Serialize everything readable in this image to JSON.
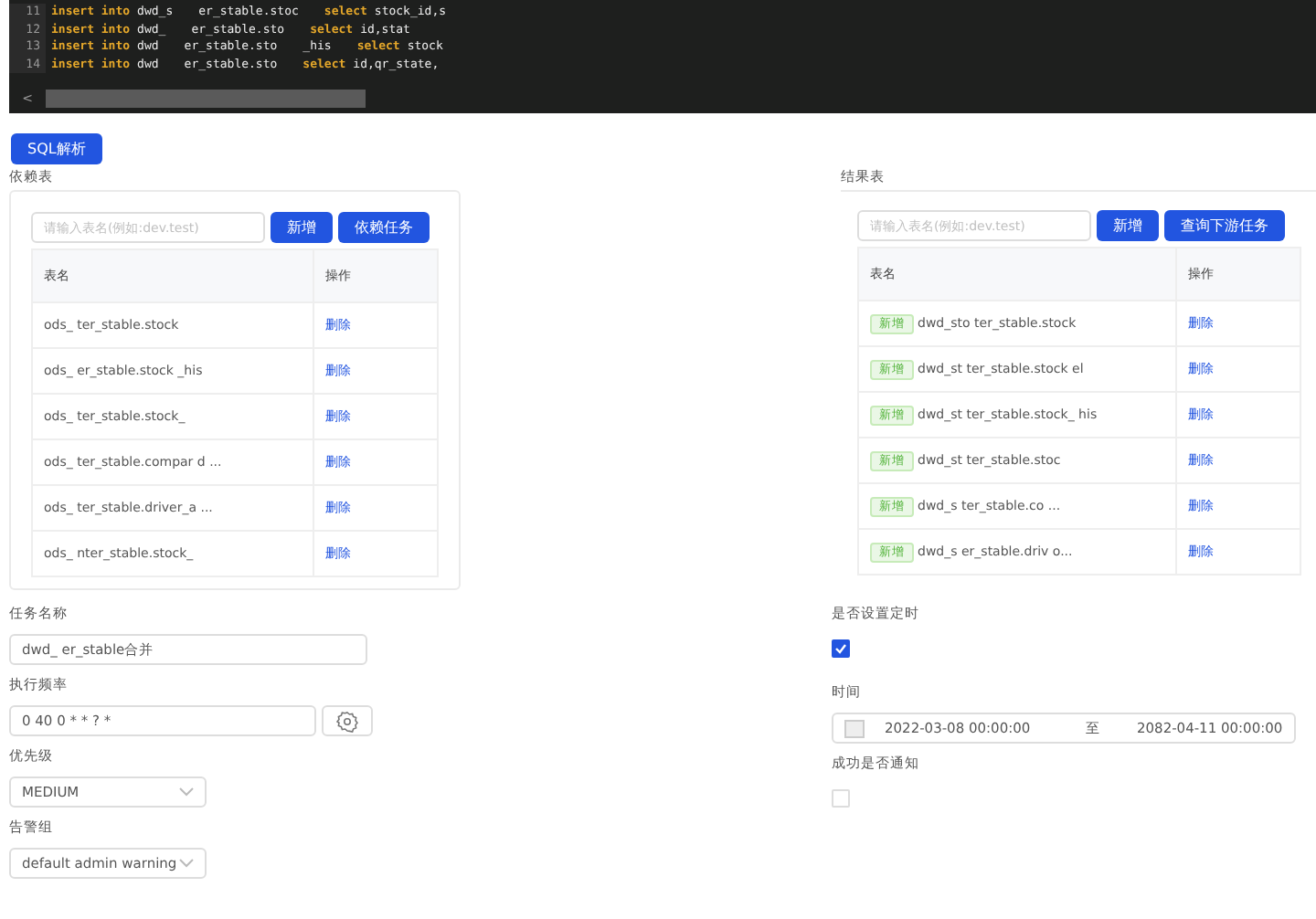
{
  "editor": {
    "lines": [
      {
        "number": "11",
        "tokens": [
          {
            "kind": "keyword",
            "text": "insert into"
          },
          {
            "kind": "text",
            "text": "dwd_s"
          },
          {
            "kind": "text",
            "text": "er_stable.stoc"
          },
          {
            "kind": "keyword",
            "text": "select"
          },
          {
            "kind": "text",
            "text": "stock_id,s"
          }
        ]
      },
      {
        "number": "12",
        "tokens": [
          {
            "kind": "keyword",
            "text": "insert into"
          },
          {
            "kind": "text",
            "text": "dwd_"
          },
          {
            "kind": "text",
            "text": "er_stable.sto"
          },
          {
            "kind": "keyword",
            "text": "select"
          },
          {
            "kind": "text",
            "text": "id,stat"
          }
        ]
      },
      {
        "number": "13",
        "tokens": [
          {
            "kind": "keyword",
            "text": "insert into"
          },
          {
            "kind": "text",
            "text": "dwd"
          },
          {
            "kind": "text",
            "text": "er_stable.sto"
          },
          {
            "kind": "text",
            "text": "_his"
          },
          {
            "kind": "keyword",
            "text": "select"
          },
          {
            "kind": "text",
            "text": "stock"
          }
        ]
      },
      {
        "number": "14",
        "tokens": [
          {
            "kind": "keyword",
            "text": "insert into"
          },
          {
            "kind": "text",
            "text": "dwd"
          },
          {
            "kind": "text",
            "text": "er_stable.sto"
          },
          {
            "kind": "keyword",
            "text": "select"
          },
          {
            "kind": "text",
            "text": "id,qr_state,"
          }
        ]
      }
    ],
    "scroll_left": "<"
  },
  "parse_button": "SQL解析",
  "dependency": {
    "title": "依赖表",
    "placeholder": "请输入表名(例如:dev.test)",
    "buttons": [
      "新增",
      "依赖任务"
    ],
    "columns": [
      "表名",
      "操作"
    ],
    "rows": [
      {
        "name": "ods_ ter_stable.stock",
        "action": "删除"
      },
      {
        "name": "ods_ er_stable.stock _his",
        "action": "删除"
      },
      {
        "name": "ods_ ter_stable.stock_",
        "action": "删除"
      },
      {
        "name": "ods_ ter_stable.compar d ...",
        "action": "删除"
      },
      {
        "name": "ods_ ter_stable.driver_a ...",
        "action": "删除"
      },
      {
        "name": "ods_ nter_stable.stock_",
        "action": "删除"
      }
    ]
  },
  "result": {
    "title": "结果表",
    "placeholder": "请输入表名(例如:dev.test)",
    "buttons": [
      "新增",
      "查询下游任务"
    ],
    "columns": [
      "表名",
      "操作"
    ],
    "rows": [
      {
        "tag": "新增",
        "name": "dwd_sto ter_stable.stock",
        "action": "删除"
      },
      {
        "tag": "新增",
        "name": "dwd_st ter_stable.stock el",
        "action": "删除"
      },
      {
        "tag": "新增",
        "name": "dwd_st ter_stable.stock_ his",
        "action": "删除"
      },
      {
        "tag": "新增",
        "name": "dwd_st ter_stable.stoc",
        "action": "删除"
      },
      {
        "tag": "新增",
        "name": "dwd_s ter_stable.co ...",
        "action": "删除"
      },
      {
        "tag": "新增",
        "name": "dwd_s er_stable.driv o...",
        "action": "删除"
      }
    ]
  },
  "form_left": [
    {
      "kind": "input",
      "label": "任务名称",
      "value": "dwd_ er_stable合并"
    },
    {
      "kind": "cron",
      "label": "执行频率",
      "value": "0 40 0 * * ? *"
    },
    {
      "kind": "select",
      "label": "优先级",
      "value": "MEDIUM"
    },
    {
      "kind": "select",
      "label": "告警组",
      "value": "default admin warning"
    }
  ],
  "form_right": [
    {
      "kind": "checkbox",
      "label": "是否设置定时",
      "checked": true
    },
    {
      "kind": "range",
      "label": "时间",
      "start": "2022-03-08 00:00:00",
      "separator": "至",
      "end": "2082-04-11 00:00:00"
    },
    {
      "kind": "checkbox",
      "label": "成功是否通知",
      "checked": false
    }
  ]
}
